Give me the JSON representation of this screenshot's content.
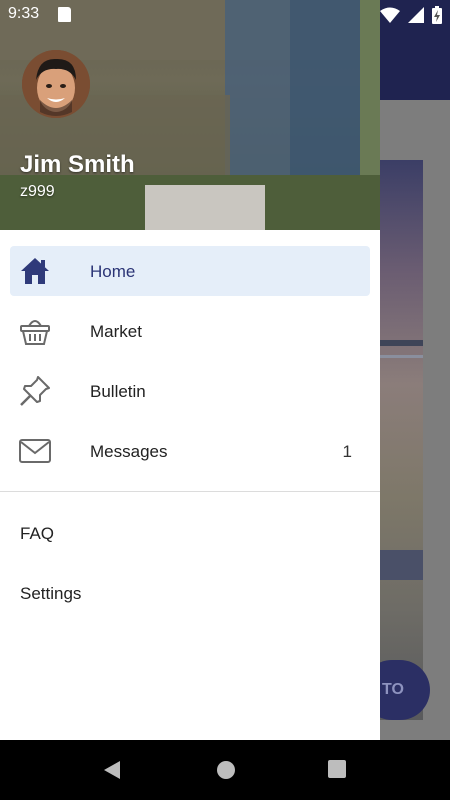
{
  "status_bar": {
    "time": "9:33"
  },
  "user": {
    "name": "Jim Smith",
    "id": "z999"
  },
  "menu": [
    {
      "label": "Home",
      "icon": "home-icon",
      "active": true,
      "badge": ""
    },
    {
      "label": "Market",
      "icon": "basket-icon",
      "active": false,
      "badge": ""
    },
    {
      "label": "Bulletin",
      "icon": "pushpin-icon",
      "active": false,
      "badge": ""
    },
    {
      "label": "Messages",
      "icon": "envelope-icon",
      "active": false,
      "badge": "1"
    }
  ],
  "secondary_menu": [
    {
      "label": "FAQ"
    },
    {
      "label": "Settings"
    }
  ],
  "background_fab": {
    "label": "TO"
  },
  "colors": {
    "accent": "#2b3476",
    "active_bg": "#e5eef9",
    "drawer_bg": "#ffffff"
  }
}
